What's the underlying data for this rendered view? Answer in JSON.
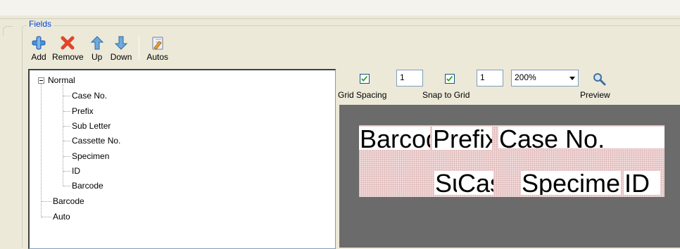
{
  "group": {
    "title": "Fields"
  },
  "toolbar": {
    "add_label": "Add",
    "remove_label": "Remove",
    "up_label": "Up",
    "down_label": "Down",
    "autos_label": "Autos",
    "icons": [
      "add-icon",
      "remove-icon",
      "up-arrow-icon",
      "down-arrow-icon",
      "autos-icon"
    ]
  },
  "tree": {
    "root_label": "Normal",
    "children": [
      "Case No.",
      "Prefix",
      "Sub Letter",
      "Cassette No.",
      "Specimen",
      "ID",
      "Barcode"
    ],
    "siblings": [
      "Barcode",
      "Auto"
    ]
  },
  "designer": {
    "grid_spacing_checked": true,
    "grid_spacing_value": "1",
    "grid_spacing_label": "Grid Spacing",
    "snap_checked": true,
    "snap_value": "1",
    "snap_label": "Snap to Grid",
    "zoom_value": "200%",
    "preview_label": "Preview"
  },
  "canvas_fields": {
    "barcode": "Barcode",
    "prefix": "Prefix",
    "case_no": "Case No.",
    "sub_letter": "Sub Letter",
    "cassette": "Cassette No.",
    "specimen": "Specimen",
    "id": "ID"
  },
  "colors": {
    "window_bg": "#ece9d8",
    "group_title": "#0046d5",
    "canvas_bg": "#6b6b6b",
    "label_bg": "#f1dada",
    "check_mark": "#21a121"
  }
}
